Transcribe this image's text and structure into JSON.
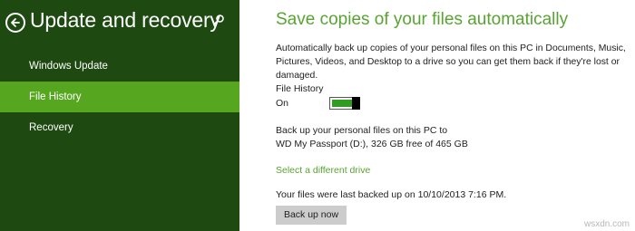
{
  "sidebar": {
    "title": "Update and recovery",
    "back_icon": "back-arrow-icon",
    "search_icon": "search-icon",
    "items": [
      {
        "label": "Windows Update",
        "selected": false
      },
      {
        "label": "File History",
        "selected": true
      },
      {
        "label": "Recovery",
        "selected": false
      }
    ],
    "bg_color": "#1e4a12",
    "selected_color": "#57a61f"
  },
  "main": {
    "heading": "Save copies of your files automatically",
    "description": "Automatically back up copies of your personal files on this PC in Documents, Music, Pictures, Videos, and Desktop to a drive so you can get them back if they're lost or damaged.",
    "file_history_label": "File History",
    "toggle_state": "On",
    "toggle_on": true,
    "backup_target_line1": "Back up your personal files on this PC to",
    "backup_target_line2": "WD My Passport (D:), 326 GB free of 465 GB",
    "select_drive_link": "Select a different drive",
    "last_backup": "Your files were last backed up on 10/10/2013 7:16 PM.",
    "backup_button": "Back up now",
    "accent_color": "#58a432"
  },
  "watermark": "wsxdn.com"
}
